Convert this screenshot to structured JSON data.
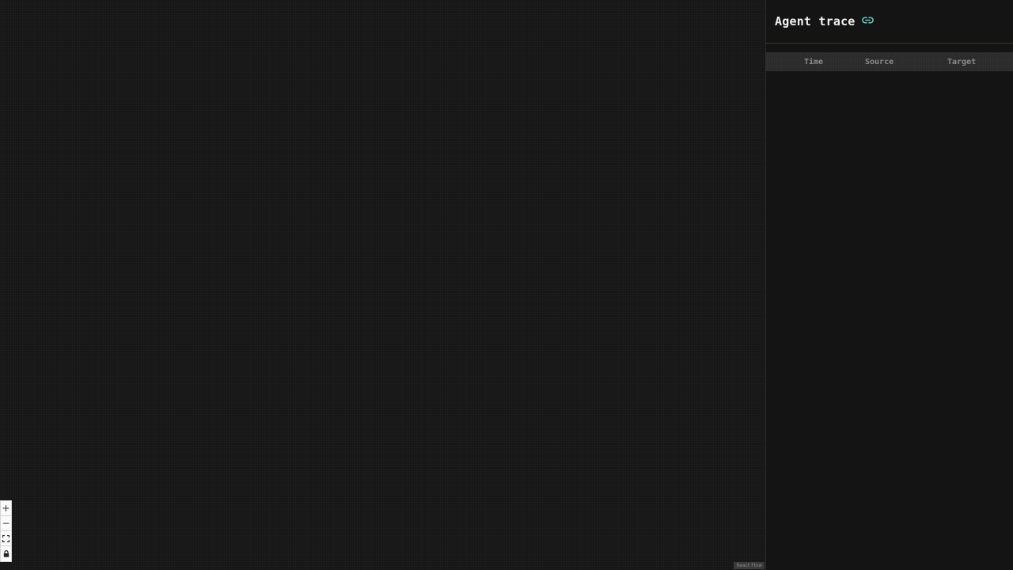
{
  "panel": {
    "title": "Agent trace",
    "columns": [
      "Time",
      "Source",
      "Target"
    ]
  },
  "canvas": {
    "attribution": "React Flow",
    "controls": [
      {
        "name": "zoom-in",
        "glyph": "+"
      },
      {
        "name": "zoom-out",
        "glyph": "−"
      },
      {
        "name": "fit-view",
        "icon": "fit-view-icon"
      },
      {
        "name": "lock",
        "icon": "lock-icon"
      }
    ]
  },
  "colors": {
    "accent": "#5fd1c6",
    "background": "#141414"
  }
}
